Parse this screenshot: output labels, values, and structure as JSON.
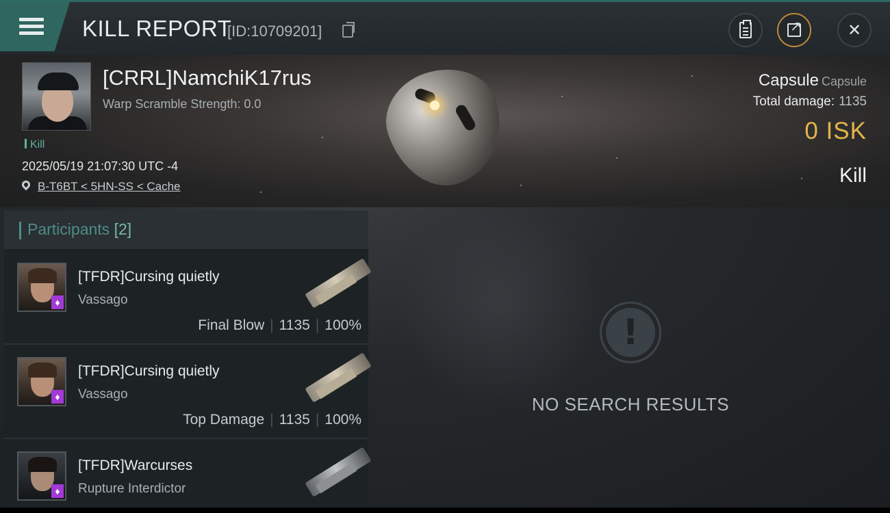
{
  "header": {
    "title": "KILL REPORT",
    "report_id": "[ID:10709201]"
  },
  "victim": {
    "name": "[CRRL]NamchiK17rus",
    "warp_scramble": "Warp Scramble Strength: 0.0",
    "result_tag": "Kill",
    "datetime": "2025/05/19 21:07:30 UTC -4",
    "location": "B-T6BT < 5HN-SS < Cache",
    "ship_name": "Capsule",
    "ship_class": "Capsule",
    "total_damage_label": "Total damage:",
    "total_damage": "1135",
    "isk": "0  ISK",
    "result": "Kill"
  },
  "participants": {
    "label": "Participants",
    "count": "[2]",
    "rows": [
      {
        "name": "[TFDR]Cursing quietly",
        "ship": "Vassago",
        "role": "Final Blow",
        "damage": "1135",
        "percent": "100%"
      },
      {
        "name": "[TFDR]Cursing quietly",
        "ship": "Vassago",
        "role": "Top Damage",
        "damage": "1135",
        "percent": "100%"
      },
      {
        "name": "[TFDR]Warcurses",
        "ship": "Rupture Interdictor"
      }
    ]
  },
  "empty_state": {
    "message": "NO SEARCH RESULTS",
    "icon": "exclamation-icon"
  },
  "colors": {
    "accent_teal": "#2f6660",
    "isk_gold": "#e5b54a",
    "kill_green": "#5fb2a2",
    "badge_purple": "#a13ad6"
  }
}
